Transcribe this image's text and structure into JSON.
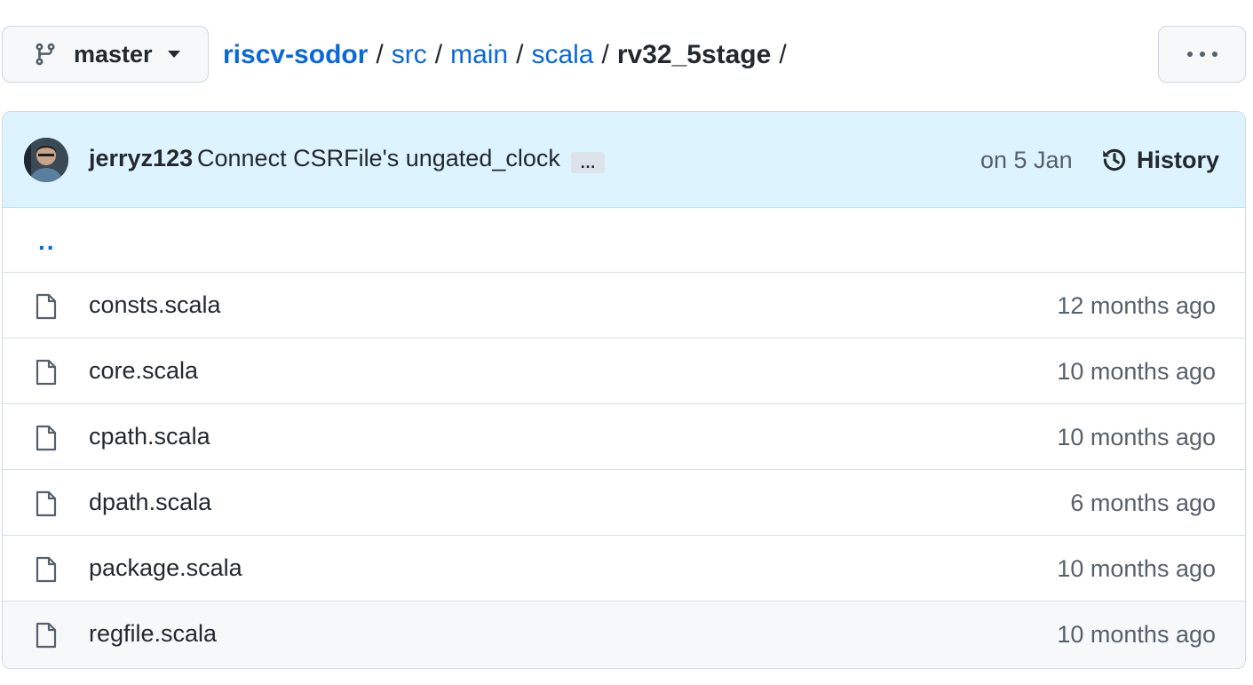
{
  "branch": {
    "label": "master",
    "icon": "git-branch-icon"
  },
  "breadcrumb": {
    "repo": "riscv-sodor",
    "parts": [
      "src",
      "main",
      "scala"
    ],
    "current": "rv32_5stage",
    "separator": "/"
  },
  "more_icon": "kebab-horizontal-icon",
  "commit": {
    "author": "jerryz123",
    "message": "Connect CSRFile's ungated_clock",
    "ellipsis": "…",
    "date": "on 5 Jan",
    "history_label": "History"
  },
  "parent_link": "..",
  "files": [
    {
      "name": "consts.scala",
      "age": "12 months ago"
    },
    {
      "name": "core.scala",
      "age": "10 months ago"
    },
    {
      "name": "cpath.scala",
      "age": "10 months ago"
    },
    {
      "name": "dpath.scala",
      "age": "6 months ago"
    },
    {
      "name": "package.scala",
      "age": "10 months ago"
    },
    {
      "name": "regfile.scala",
      "age": "10 months ago"
    }
  ],
  "colors": {
    "link": "#0969da",
    "commit_bar_bg": "#ddf4ff",
    "muted_text": "#57606a",
    "border": "#d0d7de"
  }
}
